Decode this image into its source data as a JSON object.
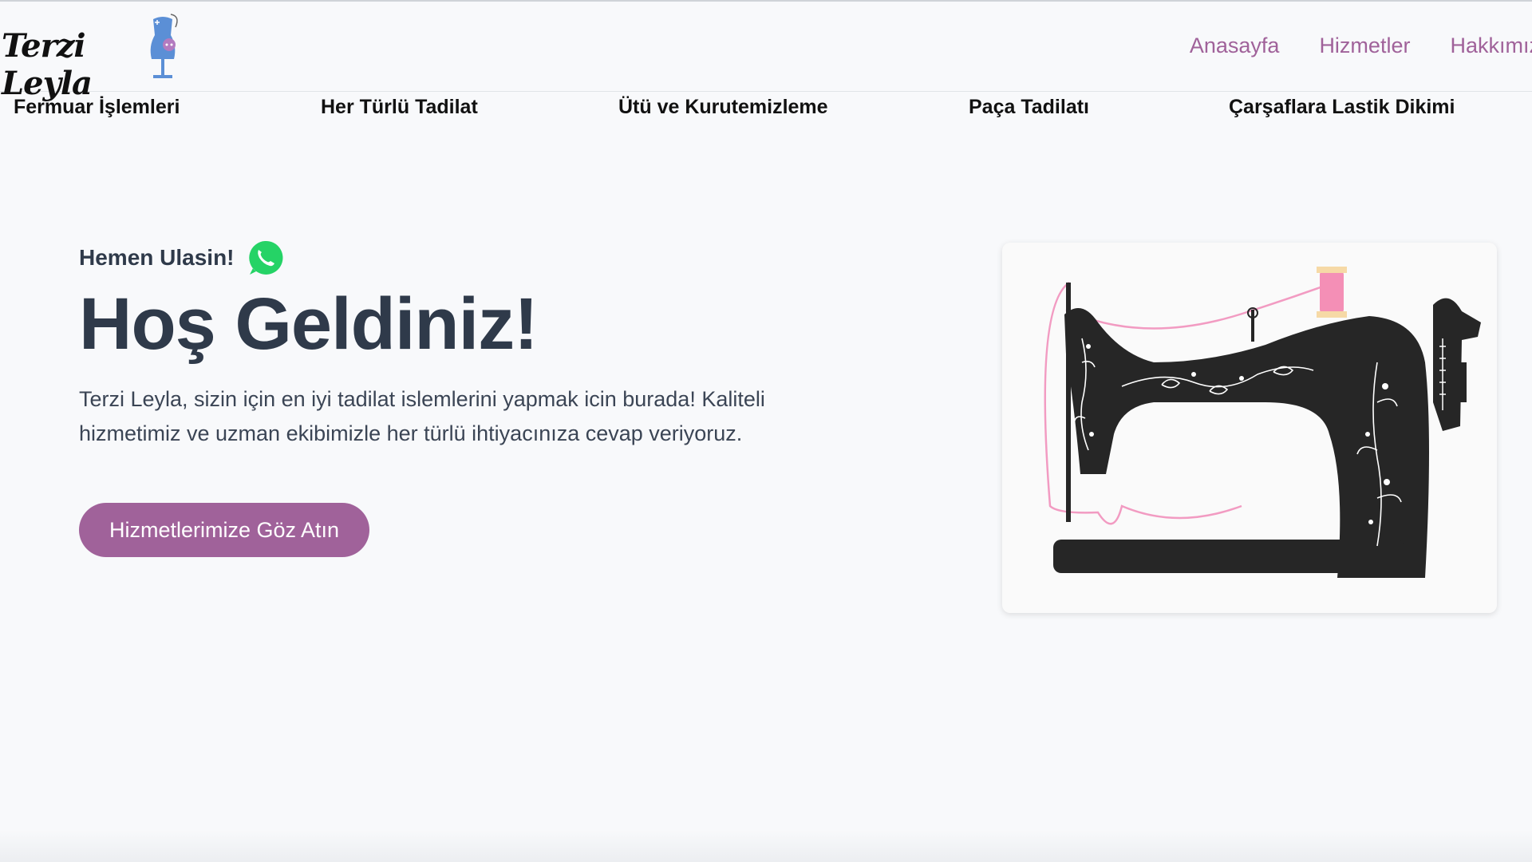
{
  "brand": {
    "logo_text": "Terzi Leyla"
  },
  "nav": {
    "items": [
      "Anasayfa",
      "Hizmetler",
      "Hakkımızda"
    ]
  },
  "services": [
    "Fermuar İşlemleri",
    "Her Türlü Tadilat",
    "Ütü ve Kurutemizleme",
    "Paça Tadilatı",
    "Çarşaflara Lastik Dikimi"
  ],
  "hero": {
    "contact_text": "Hemen Ulasin!",
    "title": "Hoş Geldiniz!",
    "description": "Terzi Leyla, sizin için en iyi tadilat islemlerini yapmak icin burada! Kaliteli hizmetimiz ve uzman ekibimizle her türlü ihtiyacınıza cevap veriyoruz.",
    "cta_label": "Hizmetlerimize Göz Atın"
  },
  "colors": {
    "accent": "#a0629a",
    "text": "#2f3a4a",
    "background": "#f8f9fb",
    "whatsapp": "#25d366"
  }
}
